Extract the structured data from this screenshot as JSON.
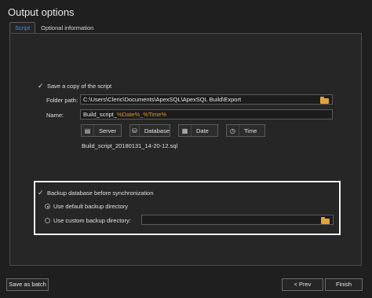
{
  "window": {
    "title": "Output options"
  },
  "tabs": [
    {
      "label": "Script",
      "active": true
    },
    {
      "label": "Optional information",
      "active": false
    }
  ],
  "script": {
    "save_copy_label": "Save a copy of the script",
    "save_copy_checked": true,
    "folder_label": "Folder path:",
    "folder_value": "C:\\Users\\Cleric\\Documents\\ApexSQL\\ApexSQL Build\\Export",
    "name_label": "Name:",
    "name_prefix": "Build_script_",
    "name_tokens": "%Date%_%Time%",
    "token_buttons": [
      {
        "label": "Server",
        "icon": "server-icon"
      },
      {
        "label": "Database",
        "icon": "database-icon"
      },
      {
        "label": "Date",
        "icon": "calendar-icon"
      },
      {
        "label": "Time",
        "icon": "clock-icon"
      }
    ],
    "preview": "Build_script_20180131_14-20-12.sql"
  },
  "backup": {
    "enable_label": "Backup database before synchronization",
    "enable_checked": true,
    "default_dir_label": "Use default backup directory",
    "custom_dir_label": "Use custom backup directory:",
    "selected": "default",
    "custom_value": ""
  },
  "footer": {
    "save_batch": "Save as batch",
    "prev": "< Prev",
    "finish": "Finish"
  },
  "colors": {
    "active_tab": "#3f8fe8",
    "token_highlight": "#e2922e",
    "folder": "#e3a33a"
  }
}
